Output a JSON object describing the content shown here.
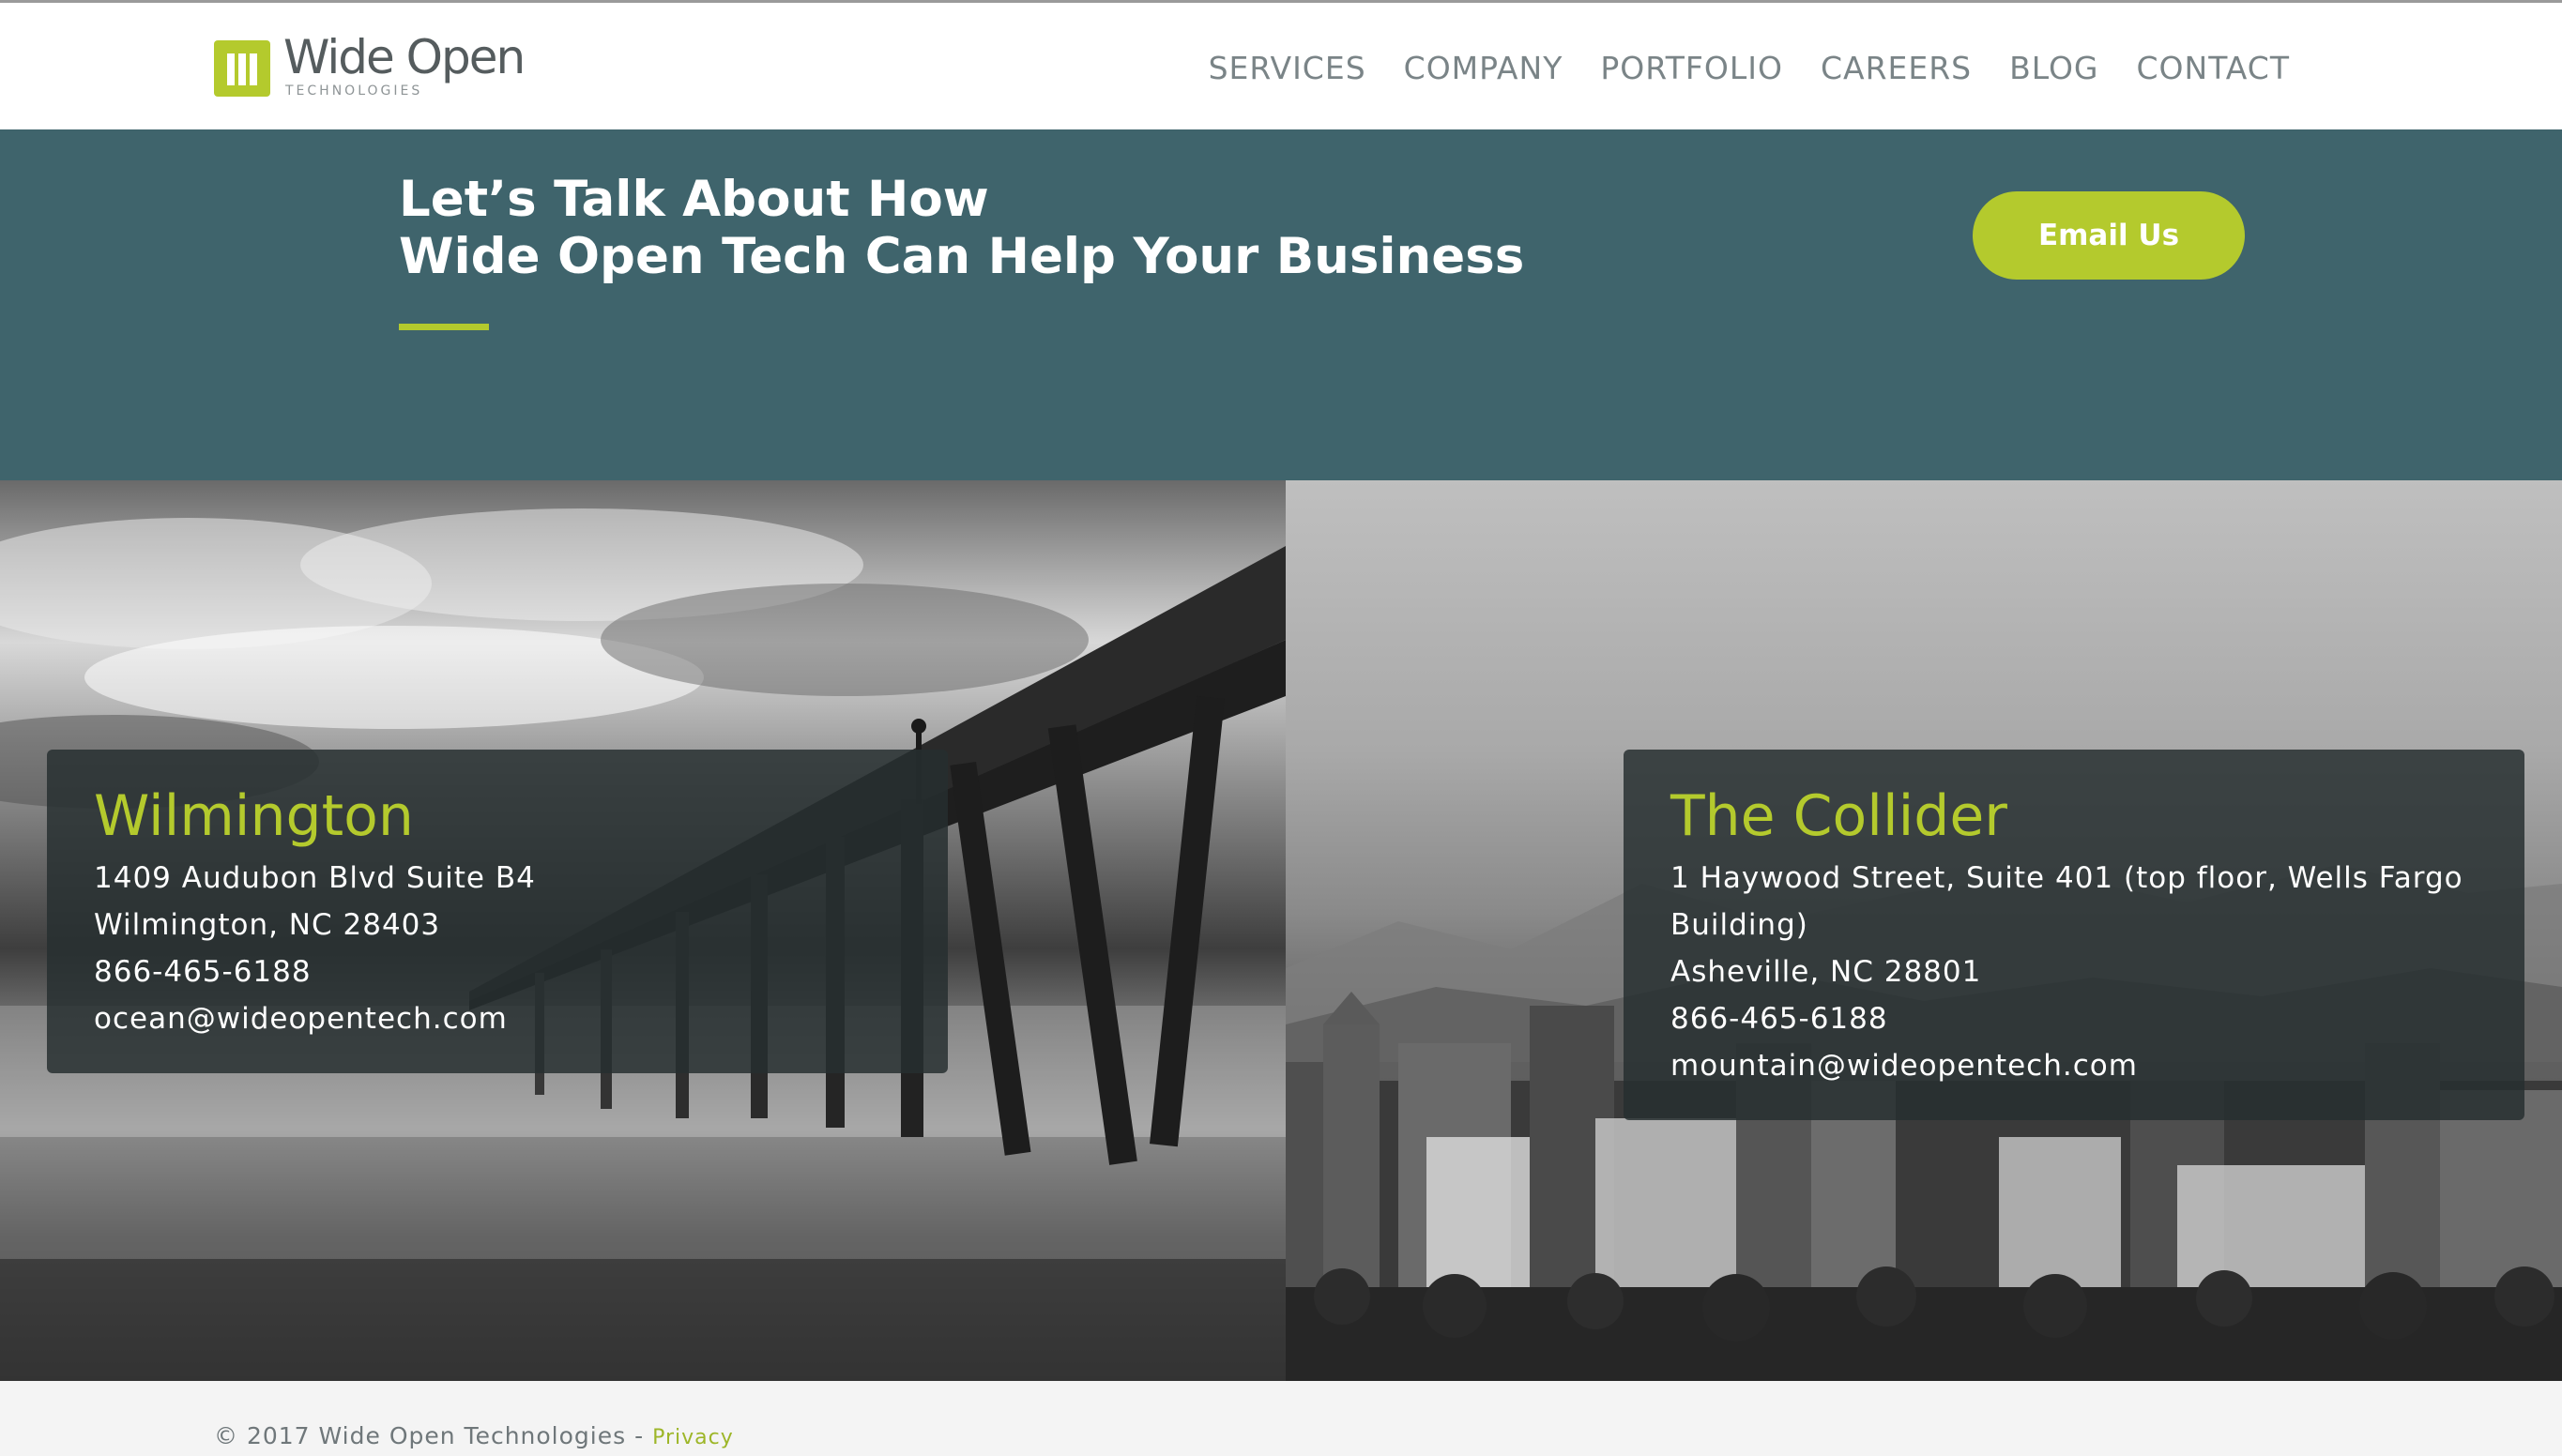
{
  "header": {
    "logo_word": "Wide Open",
    "logo_sub": "TECHNOLOGIES",
    "nav": [
      {
        "label": "SERVICES"
      },
      {
        "label": "COMPANY"
      },
      {
        "label": "PORTFOLIO"
      },
      {
        "label": "CAREERS"
      },
      {
        "label": "BLOG"
      },
      {
        "label": "CONTACT"
      }
    ]
  },
  "hero": {
    "title_line1": "Let’s Talk About How",
    "title_line2": "Wide Open Tech Can Help Your Business",
    "cta_label": "Email Us"
  },
  "locations": [
    {
      "name": "Wilmington",
      "lines": [
        "1409 Audubon Blvd Suite B4",
        "Wilmington, NC 28403",
        "866-465-6188",
        "ocean@wideopentech.com"
      ]
    },
    {
      "name": "The Collider",
      "lines": [
        "1 Haywood Street, Suite 401 (top floor, Wells Fargo",
        "Building)",
        "Asheville, NC 28801",
        "866-465-6188",
        "mountain@wideopentech.com"
      ]
    }
  ],
  "footer": {
    "copyright": "© 2017 Wide Open Technologies - ",
    "privacy_label": "Privacy"
  },
  "colors": {
    "accent": "#b4ca2d",
    "hero_bg": "#3f646c",
    "nav_text": "#7a8487",
    "footer_bg": "#f4f4f4"
  }
}
